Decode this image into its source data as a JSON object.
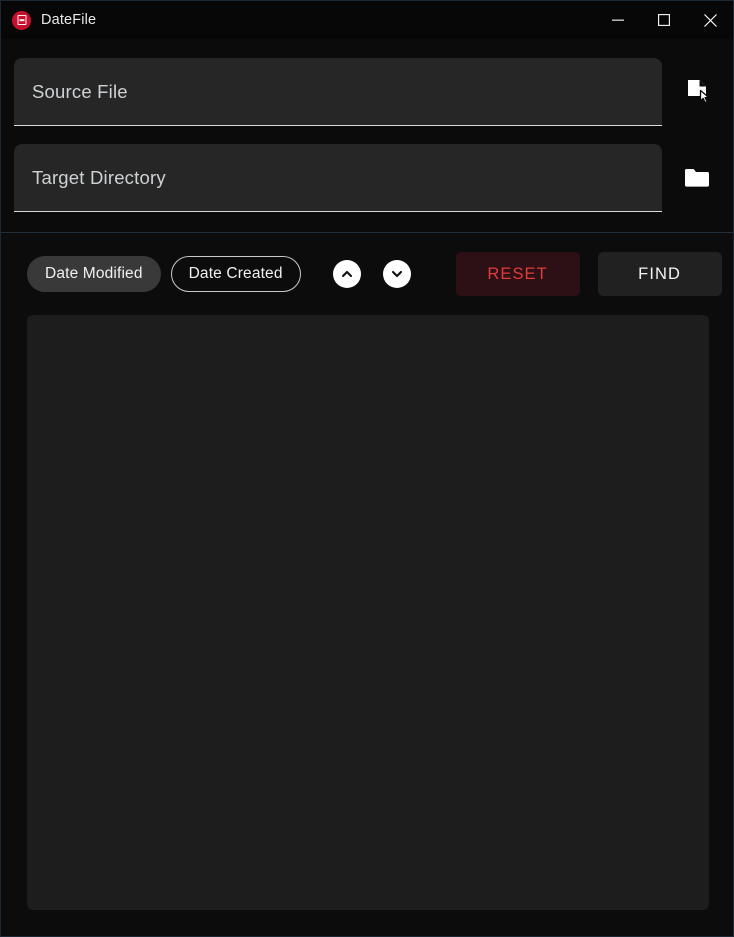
{
  "window": {
    "title": "DateFile",
    "app_icon": "app-logo-icon",
    "accent_red": "#c8102e",
    "background": "#0c0c0c",
    "border_color": "#1c2833"
  },
  "titlebar": {
    "minimize_label": "Minimize",
    "maximize_label": "Maximize",
    "close_label": "Close",
    "minimize_icon": "minimize-icon",
    "maximize_icon": "maximize-icon",
    "close_icon": "close-icon"
  },
  "fields": [
    {
      "id": "source-file",
      "label": "Source File",
      "value": "",
      "placeholder": "Source File",
      "browse_icon": "file-select-icon",
      "browse_tooltip": "Select source file"
    },
    {
      "id": "target-directory",
      "label": "Target Directory",
      "value": "",
      "placeholder": "Target Directory",
      "browse_icon": "folder-icon",
      "browse_tooltip": "Select target directory"
    }
  ],
  "controls": {
    "chips": [
      {
        "label": "Date Modified",
        "selected": true
      },
      {
        "label": "Date Created",
        "selected": false
      }
    ],
    "sort_buttons": [
      {
        "label": "Sort ascending",
        "icon": "chevron-up-icon"
      },
      {
        "label": "Sort descending",
        "icon": "chevron-down-icon"
      }
    ],
    "reset_label": "RESET",
    "reset_color": "#e23b3b",
    "reset_background": "#2c1015",
    "find_label": "FIND",
    "find_color": "#f4f4f4",
    "find_background": "#212121"
  },
  "results": {
    "items": [],
    "empty_text": "",
    "background": "#1d1d1d"
  }
}
